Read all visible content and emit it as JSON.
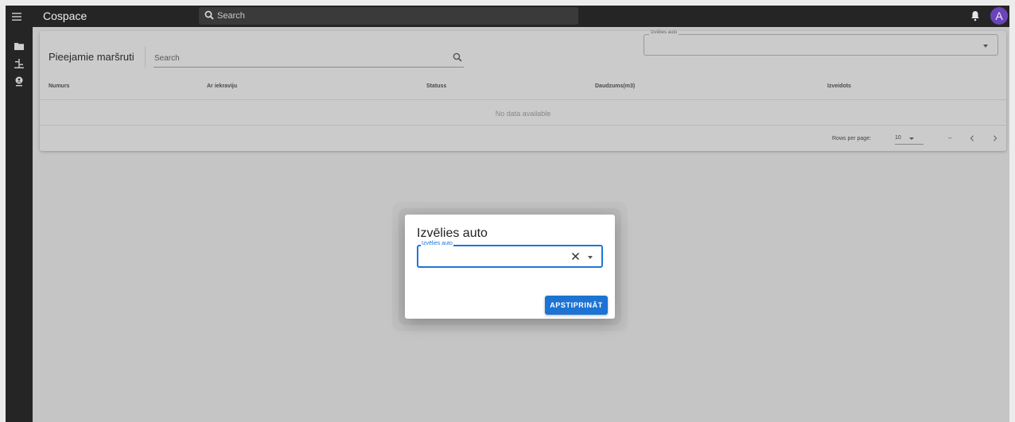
{
  "topbar": {
    "app_title": "Cospace",
    "search_placeholder": "Search",
    "avatar_initial": "A",
    "icons": [
      "menu-icon",
      "search-icon",
      "bell-icon"
    ]
  },
  "sidebar": {
    "items": [
      {
        "name": "folder",
        "icon": "folder-icon"
      },
      {
        "name": "routes",
        "icon": "signpost-icon"
      },
      {
        "name": "location",
        "icon": "person-pin-icon"
      }
    ]
  },
  "card": {
    "title": "Pieejamie maršruti",
    "search_placeholder": "Search",
    "car_select_label": "Izvēlies auto",
    "car_select_value": ""
  },
  "table": {
    "columns": [
      "Numurs",
      "Ar iekraviju",
      "Statuss",
      "Daudzums(m3)",
      "Izveidots"
    ],
    "rows": [],
    "empty_text": "No data available",
    "rows_per_page_label": "Rows per page:",
    "rows_per_page_value": "10",
    "range_text": "–"
  },
  "dialog": {
    "title": "Izvēlies auto",
    "select_label": "Izvēlies auto",
    "select_value": "",
    "confirm_label": "APSTIPRINĀT"
  },
  "colors": {
    "topbar": "#252525",
    "avatar": "#6a44b8",
    "accent": "#1c73d3",
    "overlay_background": "#c5c5c5"
  }
}
